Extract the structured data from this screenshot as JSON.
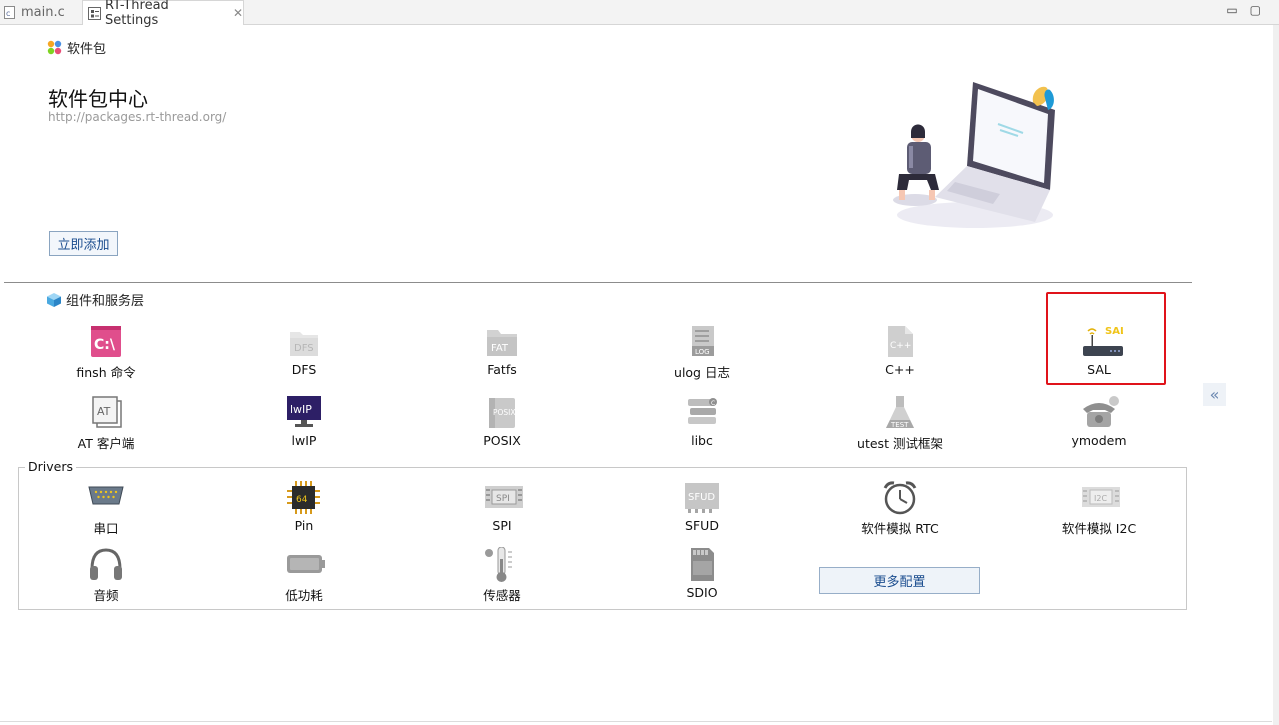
{
  "tabs": [
    {
      "label": "main.c",
      "active": false
    },
    {
      "label": "RT-Thread Settings",
      "active": true
    }
  ],
  "window_buttons": {
    "minimize": "▭",
    "maximize": "▢"
  },
  "packages": {
    "section_label": "软件包",
    "title": "软件包中心",
    "url": "http://packages.rt-thread.org/",
    "add_button": "立即添加"
  },
  "components": {
    "section_label": "组件和服务层",
    "items": [
      {
        "label": "finsh 命令",
        "icon": "finsh-terminal-icon"
      },
      {
        "label": "DFS",
        "icon": "dfs-folder-icon"
      },
      {
        "label": "Fatfs",
        "icon": "fatfs-folder-icon"
      },
      {
        "label": "ulog 日志",
        "icon": "ulog-log-icon"
      },
      {
        "label": "C++",
        "icon": "cpp-file-icon"
      },
      {
        "label": "SAL",
        "icon": "sal-router-icon"
      },
      {
        "label": "AT 客户端",
        "icon": "at-client-icon"
      },
      {
        "label": "lwIP",
        "icon": "lwip-monitor-icon"
      },
      {
        "label": "POSIX",
        "icon": "posix-doc-icon"
      },
      {
        "label": "libc",
        "icon": "libc-books-icon"
      },
      {
        "label": "utest 测试框架",
        "icon": "utest-flask-icon"
      },
      {
        "label": "ymodem",
        "icon": "ymodem-phone-icon"
      }
    ]
  },
  "drivers": {
    "section_label": "Drivers",
    "items": [
      {
        "label": "串口",
        "icon": "serial-port-icon"
      },
      {
        "label": "Pin",
        "icon": "pin-chip-icon"
      },
      {
        "label": "SPI",
        "icon": "spi-chip-icon"
      },
      {
        "label": "SFUD",
        "icon": "sfud-chip-icon"
      },
      {
        "label": "软件模拟 RTC",
        "icon": "rtc-alarm-clock-icon"
      },
      {
        "label": "软件模拟 I2C",
        "icon": "i2c-chip-icon"
      },
      {
        "label": "音频",
        "icon": "audio-headphones-icon"
      },
      {
        "label": "低功耗",
        "icon": "low-power-battery-icon"
      },
      {
        "label": "传感器",
        "icon": "sensor-thermometer-icon"
      },
      {
        "label": "SDIO",
        "icon": "sdio-card-icon"
      }
    ],
    "more_button": "更多配置"
  },
  "collapse_button": "«",
  "colors": {
    "highlight": "#e0131a",
    "link_blue": "#1b4d8f"
  }
}
